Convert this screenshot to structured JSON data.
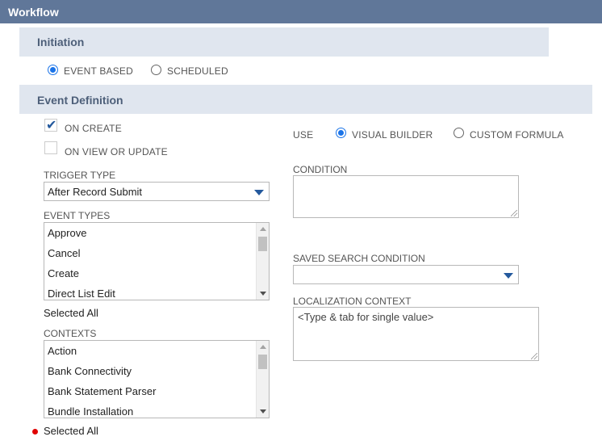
{
  "header": {
    "title": "Workflow"
  },
  "initiation": {
    "heading": "Initiation",
    "options": [
      {
        "label": "EVENT BASED",
        "checked": true
      },
      {
        "label": "SCHEDULED",
        "checked": false
      }
    ]
  },
  "event_definition": {
    "heading": "Event Definition",
    "on_create": {
      "label": "ON CREATE",
      "checked": true
    },
    "on_view_or_update": {
      "label": "ON VIEW OR UPDATE",
      "checked": false
    },
    "trigger_type": {
      "label": "TRIGGER TYPE",
      "value": "After Record Submit"
    },
    "event_types": {
      "label": "EVENT TYPES",
      "items": [
        "Approve",
        "Cancel",
        "Create",
        "Direct List Edit"
      ],
      "footer": "Selected All"
    },
    "contexts": {
      "label": "CONTEXTS",
      "items": [
        "Action",
        "Bank Connectivity",
        "Bank Statement Parser",
        "Bundle Installation"
      ],
      "footer": "Selected All"
    },
    "use": {
      "label": "USE",
      "options": [
        {
          "label": "VISUAL BUILDER",
          "checked": true
        },
        {
          "label": "CUSTOM FORMULA",
          "checked": false
        }
      ]
    },
    "condition": {
      "label": "CONDITION",
      "value": ""
    },
    "saved_search_condition": {
      "label": "SAVED SEARCH CONDITION",
      "value": ""
    },
    "localization_context": {
      "label": "LOCALIZATION CONTEXT",
      "placeholder": "<Type & tab for single value>"
    }
  },
  "colors": {
    "header_bg": "#607799",
    "section_bg": "#e0e6ef",
    "accent": "#1a73e8",
    "required_dot": "#e00000"
  }
}
